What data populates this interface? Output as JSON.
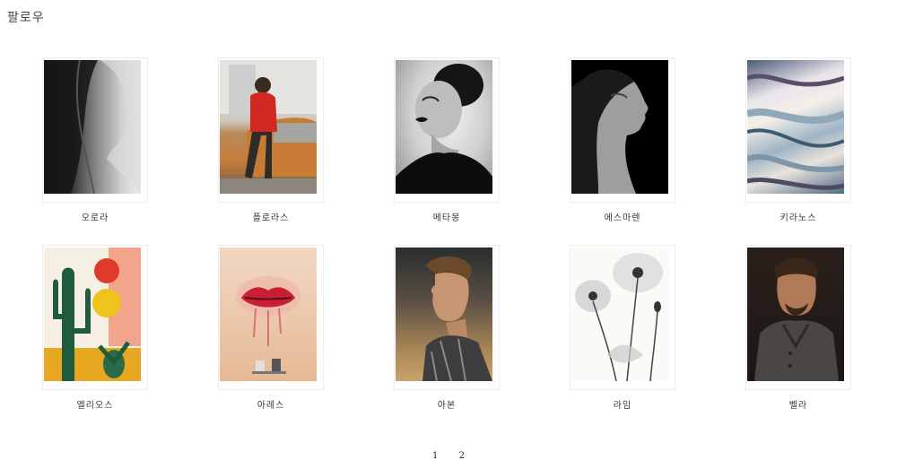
{
  "header": {
    "title": "팔로우"
  },
  "artworks": [
    {
      "name": "오로라",
      "icon": "portrait-profile-bw-photo"
    },
    {
      "name": "플로라스",
      "icon": "man-on-orange-car-photo"
    },
    {
      "name": "메타몽",
      "icon": "woman-turtleneck-bw-photo"
    },
    {
      "name": "에스마렌",
      "icon": "woman-profile-black-bg-photo"
    },
    {
      "name": "키라노스",
      "icon": "marble-abstract-art"
    },
    {
      "name": "엘리오스",
      "icon": "cactus-sun-illustration"
    },
    {
      "name": "아레스",
      "icon": "red-lips-watercolor-art"
    },
    {
      "name": "아본",
      "icon": "man-profile-portrait-photo"
    },
    {
      "name": "라임",
      "icon": "poppy-flower-sketch"
    },
    {
      "name": "벨라",
      "icon": "man-in-sweater-portrait-photo"
    }
  ],
  "pagination": {
    "pages": [
      "1",
      "2"
    ]
  }
}
